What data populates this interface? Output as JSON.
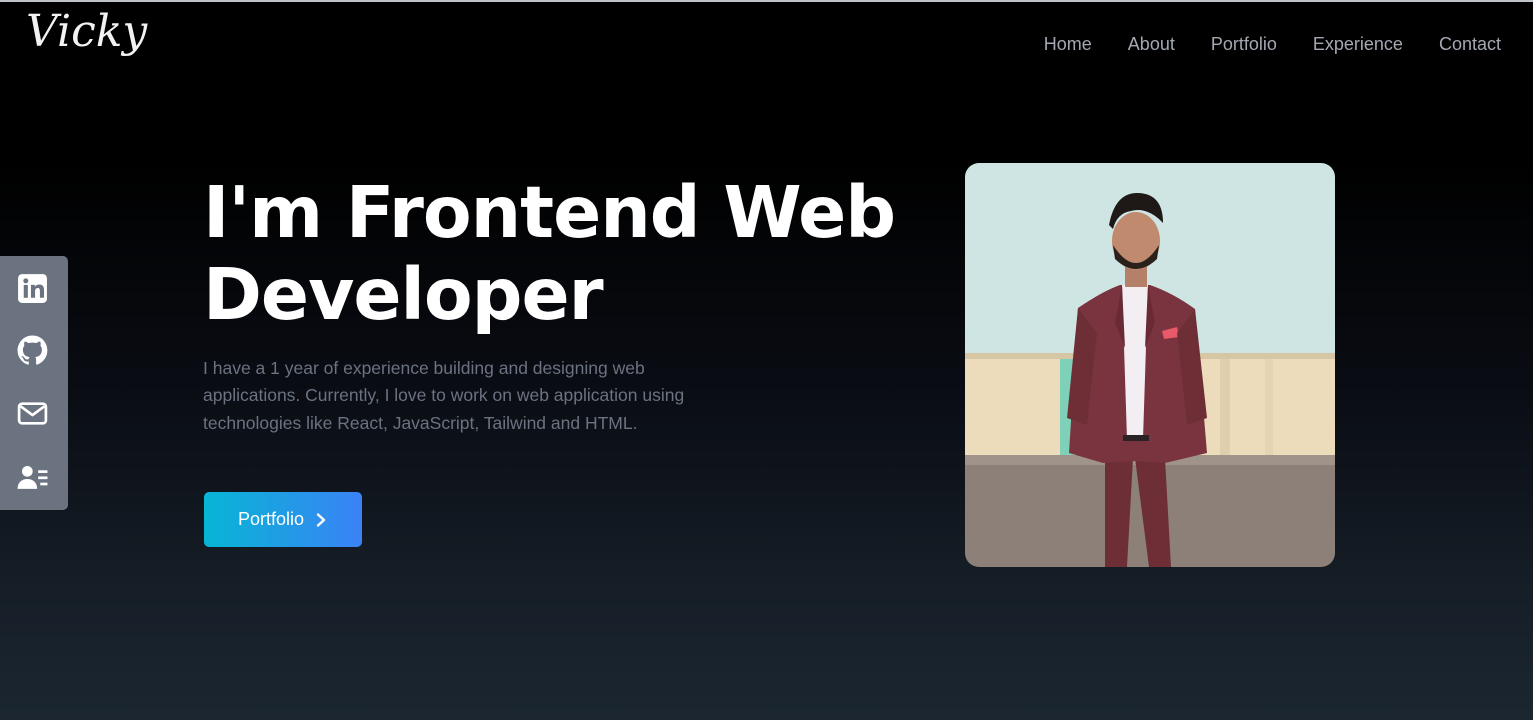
{
  "brand": {
    "logo_text": "Vicky"
  },
  "nav": {
    "items": [
      {
        "label": "Home"
      },
      {
        "label": "About"
      },
      {
        "label": "Portfolio"
      },
      {
        "label": "Experience"
      },
      {
        "label": "Contact"
      }
    ]
  },
  "social": {
    "icons": [
      "linkedin-icon",
      "github-icon",
      "mail-icon",
      "resume-icon"
    ],
    "panel_color": "#6b7280"
  },
  "hero": {
    "title_line1": "I'm Frontend Web",
    "title_line2": "Developer",
    "description": "I have a 1 year of experience building and designing web applications. Currently, I love to work on web application using technologies like React, JavaScript, Tailwind and HTML.",
    "cta_label": "Portfolio",
    "cta_icon": "chevron-right-icon",
    "cta_gradient": [
      "#06b6d4",
      "#3b82f6"
    ]
  }
}
